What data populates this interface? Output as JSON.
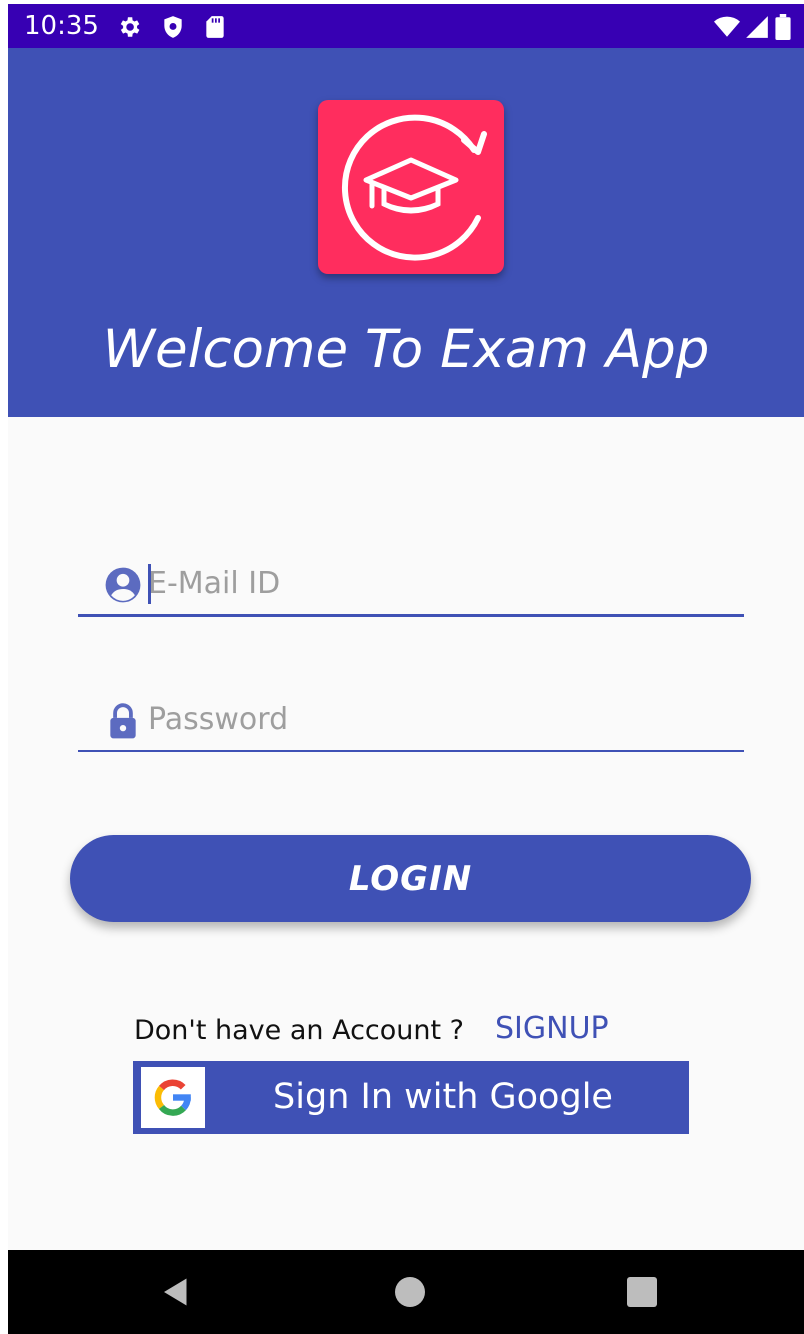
{
  "status_bar": {
    "time": "10:35",
    "left_icons": [
      "gear-icon",
      "shield-icon",
      "sd-card-icon"
    ],
    "right_icons": [
      "wifi-icon",
      "signal-icon",
      "battery-icon"
    ]
  },
  "header": {
    "logo_icon": "graduation-cap-refresh-icon",
    "title": "Welcome To Exam App"
  },
  "form": {
    "email_placeholder": "E-Mail ID",
    "email_value": "",
    "password_placeholder": "Password",
    "password_value": ""
  },
  "login": {
    "label": "LOGIN"
  },
  "signup": {
    "prompt": "Don't have an Account ?",
    "link": "SIGNUP"
  },
  "google": {
    "label": "Sign In with Google"
  },
  "colors": {
    "status_bar": "#3700b3",
    "primary": "#3f51b5",
    "logo_background": "#ff2d5e",
    "background": "#fafafa"
  }
}
